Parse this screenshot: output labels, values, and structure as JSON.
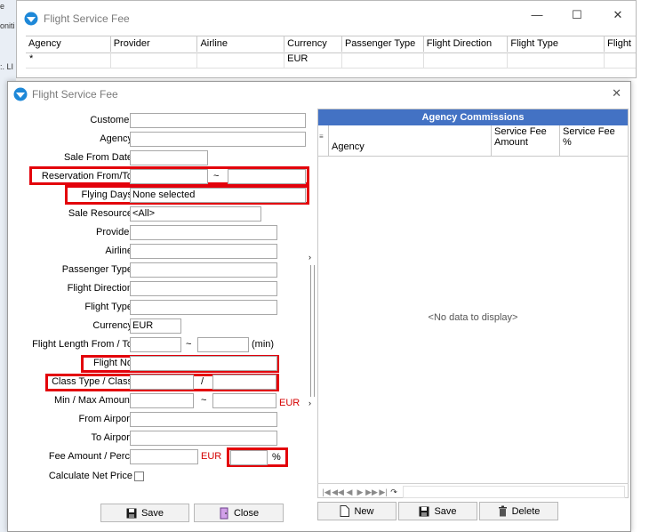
{
  "desktop": {
    "fragments": [
      "e",
      "oniti",
      ":. LI"
    ]
  },
  "background_window": {
    "title": "Flight Service Fee",
    "controls": {
      "minimize": "—",
      "maximize": "☐",
      "close": "✕"
    },
    "columns": [
      "Agency",
      "Provider",
      "Airline",
      "Currency",
      "Passenger Type",
      "Flight Direction",
      "Flight Type",
      "Flight"
    ],
    "new_row": {
      "marker": "*",
      "currency": "EUR"
    }
  },
  "dialog": {
    "title": "Flight Service Fee",
    "close_glyph": "✕",
    "form": {
      "customer": {
        "label": "Customer",
        "value": ""
      },
      "agency": {
        "label": "Agency",
        "value": ""
      },
      "sale_from_date": {
        "label": "Sale From Date",
        "value": ""
      },
      "reservation": {
        "label": "Reservation From/To",
        "from": "",
        "sep": "~",
        "to": ""
      },
      "flying_days": {
        "label": "Flying Days",
        "value": "None selected"
      },
      "sale_resource": {
        "label": "Sale Resource",
        "value": "<All>"
      },
      "provider": {
        "label": "Provider",
        "value": ""
      },
      "airline": {
        "label": "Airline",
        "value": ""
      },
      "passenger_type": {
        "label": "Passenger Type",
        "value": ""
      },
      "flight_direction": {
        "label": "Flight Direction",
        "value": ""
      },
      "flight_type": {
        "label": "Flight Type",
        "value": ""
      },
      "currency": {
        "label": "Currency",
        "value": "EUR"
      },
      "flight_length": {
        "label": "Flight Length From / To",
        "from": "",
        "sep": "~",
        "to": "",
        "unit": "(min)"
      },
      "flight_no": {
        "label": "Flight No",
        "value": ""
      },
      "class_type": {
        "label": "Class Type / Class",
        "type": "",
        "sep": "/",
        "class": ""
      },
      "amount": {
        "label": "Min / Max Amount",
        "min": "",
        "sep": "~",
        "max": "",
        "currency": "EUR"
      },
      "from_airport": {
        "label": "From Airport",
        "value": ""
      },
      "to_airport": {
        "label": "To Airport",
        "value": ""
      },
      "fee": {
        "label": "Fee Amount / Perc.",
        "amount": "",
        "currency": "EUR",
        "perc": "",
        "perc_sign": "%"
      },
      "calc_net_price": {
        "label": "Calculate Net Price",
        "checked": false
      }
    },
    "buttons": {
      "save": "Save",
      "close": "Close"
    },
    "commissions": {
      "title": "Agency Commissions",
      "columns": [
        "Agency",
        "Service Fee Amount",
        "Service Fee %"
      ],
      "empty": "<No data to display>",
      "nav_glyphs": [
        "|◀",
        "◀◀",
        "◀",
        "▶",
        "▶▶",
        "▶|",
        "↷"
      ],
      "buttons": {
        "new": "New",
        "save": "Save",
        "delete": "Delete"
      }
    },
    "colors": {
      "header_blue": "#4372c4",
      "highlight_red": "#e3000b",
      "currency_red": "#d40000"
    }
  }
}
